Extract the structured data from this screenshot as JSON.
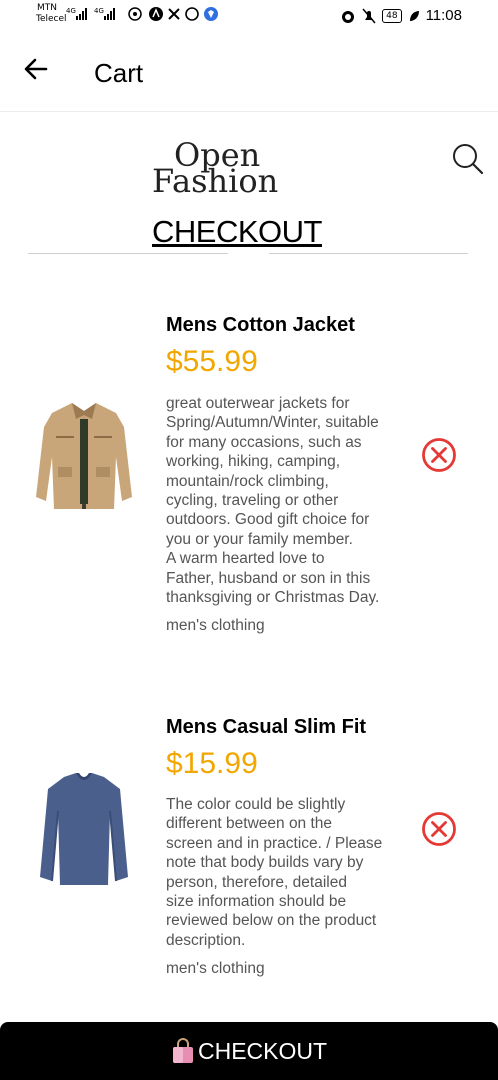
{
  "status_bar": {
    "carrier_line1": "MTN",
    "carrier_line2": "Telecel",
    "battery": "48",
    "time": "11:08"
  },
  "appbar": {
    "title": "Cart"
  },
  "logo": {
    "line1": "Open",
    "line2": "Fashion"
  },
  "checkout_heading": "CHECKOUT",
  "items": [
    {
      "name": "Mens Cotton Jacket",
      "price": "$55.99",
      "description": "great outerwear jackets for\nSpring/Autumn/Winter, suitable\nfor many occasions, such as\nworking, hiking, camping,\nmountain/rock climbing,\ncycling, traveling or other\noutdoors. Good gift choice for\nyou or your family member.\nA warm hearted love to\nFather, husband or son in this\nthanksgiving or Christmas Day.",
      "category": "men's clothing"
    },
    {
      "name": "Mens Casual Slim Fit",
      "price": "$15.99",
      "description": "The color could be slightly\ndifferent between on the\nscreen and in practice. / Please\nnote that body builds vary by\nperson, therefore, detailed\nsize information should be\nreviewed below on the product\ndescription.",
      "category": "men's clothing"
    }
  ],
  "bottom_button": {
    "label": "CHECKOUT"
  },
  "colors": {
    "price": "#f2a600",
    "remove": "#e53935",
    "button_bg": "#000000"
  },
  "icons": [
    "back-arrow-icon",
    "search-icon",
    "remove-circle-x-icon",
    "shopping-bag-icon"
  ]
}
